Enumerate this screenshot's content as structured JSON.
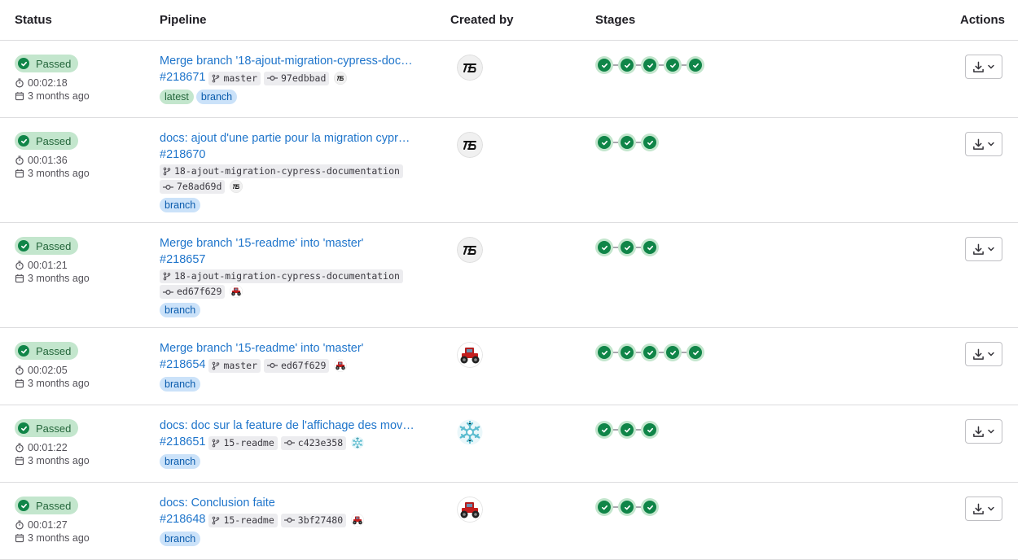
{
  "headers": {
    "status": "Status",
    "pipeline": "Pipeline",
    "created_by": "Created by",
    "stages": "Stages",
    "actions": "Actions"
  },
  "rows": [
    {
      "status": "Passed",
      "duration": "00:02:18",
      "finished": "3 months ago",
      "title": "Merge branch '18-ajout-migration-cypress-doc…",
      "id": "#218671",
      "ref": "master",
      "ref_inline": true,
      "commit": "97edbbad",
      "commit_avatar": "logo",
      "tags": [
        "latest",
        "branch"
      ],
      "avatar": "logo",
      "stage_count": 5
    },
    {
      "status": "Passed",
      "duration": "00:01:36",
      "finished": "3 months ago",
      "title": "docs: ajout d'une partie pour la migration cypr…",
      "id": "#218670",
      "ref": "18-ajout-migration-cypress-documentation",
      "ref_inline": false,
      "commit": "7e8ad69d",
      "commit_avatar": "logo",
      "tags": [
        "branch"
      ],
      "avatar": "logo",
      "stage_count": 3
    },
    {
      "status": "Passed",
      "duration": "00:01:21",
      "finished": "3 months ago",
      "title": "Merge branch '15-readme' into 'master'",
      "id": "#218657",
      "ref": "18-ajout-migration-cypress-documentation",
      "ref_inline": false,
      "commit": "ed67f629",
      "commit_avatar": "tractor",
      "tags": [
        "branch"
      ],
      "avatar": "logo",
      "stage_count": 3
    },
    {
      "status": "Passed",
      "duration": "00:02:05",
      "finished": "3 months ago",
      "title": "Merge branch '15-readme' into 'master'",
      "id": "#218654",
      "ref": "master",
      "ref_inline": true,
      "commit": "ed67f629",
      "commit_avatar": "tractor",
      "tags": [
        "branch"
      ],
      "avatar": "tractor",
      "stage_count": 5
    },
    {
      "status": "Passed",
      "duration": "00:01:22",
      "finished": "3 months ago",
      "title": "docs: doc sur la feature de l'affichage des mov…",
      "id": "#218651",
      "ref": "15-readme",
      "ref_inline": true,
      "commit": "c423e358",
      "commit_avatar": "snowflake",
      "tags": [
        "branch"
      ],
      "avatar": "snowflake",
      "stage_count": 3
    },
    {
      "status": "Passed",
      "duration": "00:01:27",
      "finished": "3 months ago",
      "title": "docs: Conclusion faite",
      "id": "#218648",
      "ref": "15-readme",
      "ref_inline": true,
      "commit": "3bf27480",
      "commit_avatar": "tractor",
      "tags": [
        "branch"
      ],
      "avatar": "tractor",
      "stage_count": 3
    }
  ],
  "icons": {
    "status": "check-circle-icon",
    "duration": "timer-icon",
    "finished": "calendar-icon",
    "ref": "branch-icon",
    "commit": "commit-icon",
    "stage": "check-circle-icon",
    "download": "download-icon",
    "dropdown": "chevron-down-icon"
  },
  "colors": {
    "link": "#1f75cb",
    "success": "#108548",
    "success_bg": "#c3e6cd",
    "branch_tag_bg": "#cbe2f9"
  }
}
